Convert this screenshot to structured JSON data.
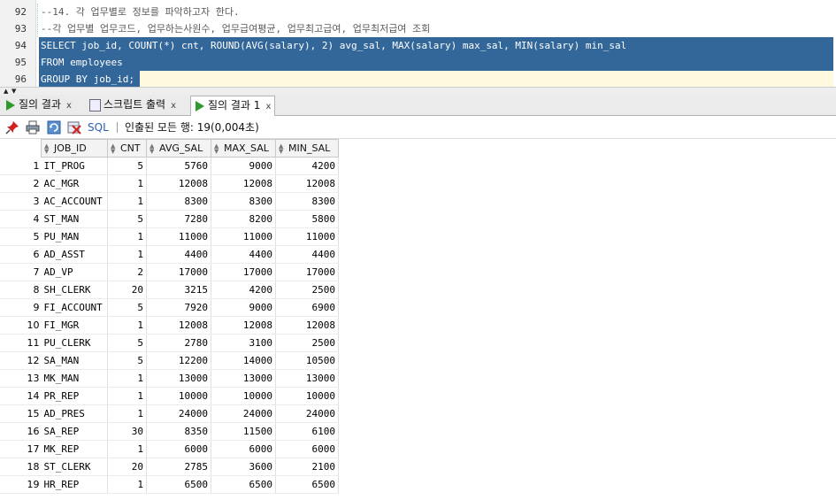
{
  "editor": {
    "lines": [
      {
        "num": "92",
        "text": "--14. 각 업무별로 정보를 파악하고자 한다.",
        "kind": "comment"
      },
      {
        "num": "93",
        "text": "--각 업무별 업무코드, 업무하는사원수, 업무급여평균, 업무최고급여, 업무최저급여 조회",
        "kind": "comment"
      },
      {
        "num": "94",
        "text": "SELECT job_id, COUNT(*) cnt, ROUND(AVG(salary), 2) avg_sal, MAX(salary) max_sal, MIN(salary) min_sal",
        "kind": "selected"
      },
      {
        "num": "95",
        "text": "FROM employees",
        "kind": "selected"
      },
      {
        "num": "96",
        "text": "GROUP BY job_id;",
        "kind": "selected-last"
      }
    ]
  },
  "tabs": [
    {
      "label": "질의 결과",
      "icon": "play-icon",
      "close": "x",
      "active": false
    },
    {
      "label": "스크립트 출력",
      "icon": "script-output-icon",
      "close": "x",
      "active": false
    },
    {
      "label": "질의 결과 1",
      "icon": "play-icon",
      "close": "x",
      "active": true
    }
  ],
  "toolbar": {
    "pin_icon": "pin-icon",
    "print_icon": "print-icon",
    "refresh_icon": "refresh-icon",
    "cancel_icon": "cancel-query-icon",
    "sql_label": "SQL",
    "separator": "|",
    "status": "인출된 모든 행: 19(0,004초)"
  },
  "grid": {
    "columns": [
      "JOB_ID",
      "CNT",
      "AVG_SAL",
      "MAX_SAL",
      "MIN_SAL"
    ],
    "rows": [
      [
        "1",
        "IT_PROG",
        "5",
        "5760",
        "9000",
        "4200"
      ],
      [
        "2",
        "AC_MGR",
        "1",
        "12008",
        "12008",
        "12008"
      ],
      [
        "3",
        "AC_ACCOUNT",
        "1",
        "8300",
        "8300",
        "8300"
      ],
      [
        "4",
        "ST_MAN",
        "5",
        "7280",
        "8200",
        "5800"
      ],
      [
        "5",
        "PU_MAN",
        "1",
        "11000",
        "11000",
        "11000"
      ],
      [
        "6",
        "AD_ASST",
        "1",
        "4400",
        "4400",
        "4400"
      ],
      [
        "7",
        "AD_VP",
        "2",
        "17000",
        "17000",
        "17000"
      ],
      [
        "8",
        "SH_CLERK",
        "20",
        "3215",
        "4200",
        "2500"
      ],
      [
        "9",
        "FI_ACCOUNT",
        "5",
        "7920",
        "9000",
        "6900"
      ],
      [
        "10",
        "FI_MGR",
        "1",
        "12008",
        "12008",
        "12008"
      ],
      [
        "11",
        "PU_CLERK",
        "5",
        "2780",
        "3100",
        "2500"
      ],
      [
        "12",
        "SA_MAN",
        "5",
        "12200",
        "14000",
        "10500"
      ],
      [
        "13",
        "MK_MAN",
        "1",
        "13000",
        "13000",
        "13000"
      ],
      [
        "14",
        "PR_REP",
        "1",
        "10000",
        "10000",
        "10000"
      ],
      [
        "15",
        "AD_PRES",
        "1",
        "24000",
        "24000",
        "24000"
      ],
      [
        "16",
        "SA_REP",
        "30",
        "8350",
        "11500",
        "6100"
      ],
      [
        "17",
        "MK_REP",
        "1",
        "6000",
        "6000",
        "6000"
      ],
      [
        "18",
        "ST_CLERK",
        "20",
        "2785",
        "3600",
        "2100"
      ],
      [
        "19",
        "HR_REP",
        "1",
        "6500",
        "6500",
        "6500"
      ]
    ]
  }
}
